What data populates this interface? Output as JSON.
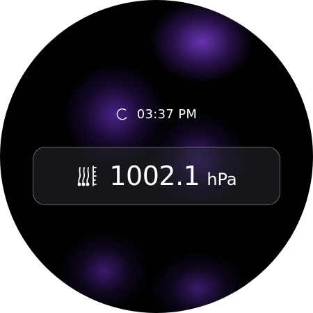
{
  "clock": {
    "time": "03:37 PM",
    "icon": "clock-icon"
  },
  "pressure": {
    "value": "1002.1",
    "unit": "hPa",
    "icon": "barometer-icon"
  },
  "colors": {
    "background": "#000000",
    "accent": "#6e37be",
    "text": "#ffffff"
  }
}
